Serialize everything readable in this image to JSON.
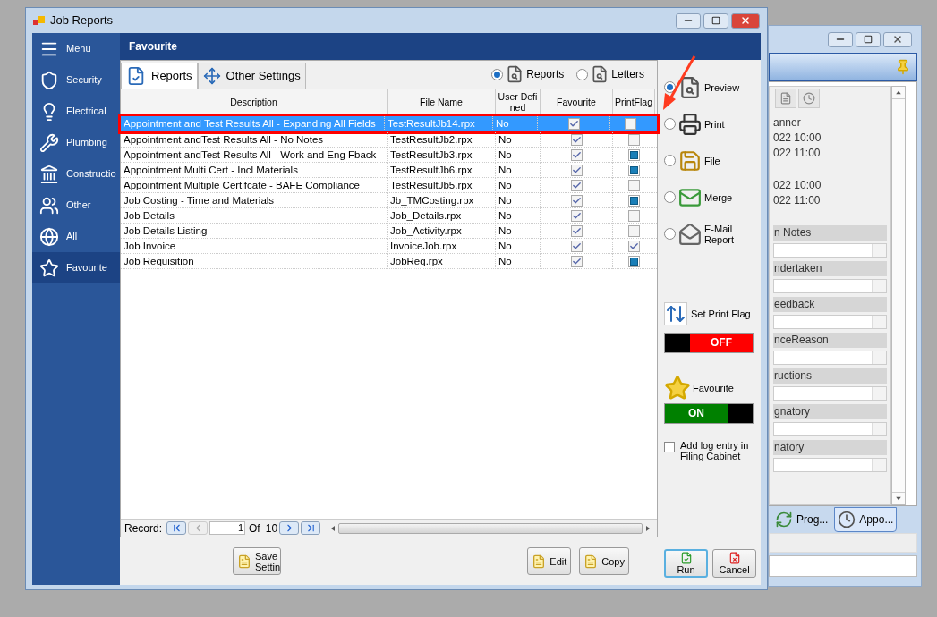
{
  "main_window": {
    "title": "Job Reports",
    "sidebar": [
      {
        "label": "Menu",
        "kind": "menu",
        "selected": false
      },
      {
        "label": "Security",
        "kind": "security",
        "selected": false
      },
      {
        "label": "Electrical",
        "kind": "electrical",
        "selected": false
      },
      {
        "label": "Plumbing",
        "kind": "plumbing",
        "selected": false
      },
      {
        "label": "Constructio",
        "kind": "construction",
        "selected": false
      },
      {
        "label": "Other",
        "kind": "other",
        "selected": false
      },
      {
        "label": "All",
        "kind": "all",
        "selected": false
      },
      {
        "label": "Favourite",
        "kind": "favourite",
        "selected": true
      }
    ],
    "header": "Favourite",
    "tabs": [
      {
        "label": "Reports",
        "kind": "reports",
        "selected": true
      },
      {
        "label": "Other Settings",
        "kind": "settings",
        "selected": false
      }
    ],
    "source_options": [
      {
        "label": "Reports",
        "selected": true
      },
      {
        "label": "Letters",
        "selected": false
      }
    ],
    "table": {
      "columns": [
        "Description",
        "File Name",
        "User Defined",
        "Favourite",
        "PrintFlag"
      ],
      "rows": [
        {
          "description": "Appointment and Test Results All - Expanding All Fields",
          "file_name": "TestResultJb14.rpx",
          "user_defined": "No",
          "favourite": true,
          "print_flag_checked": false,
          "print_flag_indeterminate": false,
          "selected": true
        },
        {
          "description": "Appointment andTest Results All - No Notes",
          "file_name": "TestResultJb2.rpx",
          "user_defined": "No",
          "favourite": true,
          "print_flag_checked": false,
          "print_flag_indeterminate": false,
          "selected": false
        },
        {
          "description": "Appointment andTest Results All - Work and Eng Fback",
          "file_name": "TestResultJb3.rpx",
          "user_defined": "No",
          "favourite": true,
          "print_flag_checked": false,
          "print_flag_indeterminate": true,
          "selected": false
        },
        {
          "description": "Appointment Multi Cert - Incl Materials",
          "file_name": "TestResultJb6.rpx",
          "user_defined": "No",
          "favourite": true,
          "print_flag_checked": false,
          "print_flag_indeterminate": true,
          "selected": false
        },
        {
          "description": "Appointment Multiple Certifcate - BAFE Compliance",
          "file_name": "TestResultJb5.rpx",
          "user_defined": "No",
          "favourite": true,
          "print_flag_checked": false,
          "print_flag_indeterminate": false,
          "selected": false
        },
        {
          "description": "Job Costing - Time and Materials",
          "file_name": "Jb_TMCosting.rpx",
          "user_defined": "No",
          "favourite": true,
          "print_flag_checked": false,
          "print_flag_indeterminate": true,
          "selected": false
        },
        {
          "description": "Job Details",
          "file_name": "Job_Details.rpx",
          "user_defined": "No",
          "favourite": true,
          "print_flag_checked": false,
          "print_flag_indeterminate": false,
          "selected": false
        },
        {
          "description": "Job Details Listing",
          "file_name": "Job_Activity.rpx",
          "user_defined": "No",
          "favourite": true,
          "print_flag_checked": false,
          "print_flag_indeterminate": false,
          "selected": false
        },
        {
          "description": "Job Invoice",
          "file_name": "InvoiceJob.rpx",
          "user_defined": "No",
          "favourite": true,
          "print_flag_checked": true,
          "print_flag_indeterminate": false,
          "selected": false
        },
        {
          "description": "Job Requisition",
          "file_name": "JobReq.rpx",
          "user_defined": "No",
          "favourite": true,
          "print_flag_checked": false,
          "print_flag_indeterminate": true,
          "selected": false
        }
      ]
    },
    "navigator": {
      "label": "Record:",
      "current": "1",
      "of_label": "Of",
      "total": "10"
    },
    "output_options": [
      {
        "label": "Preview",
        "kind": "preview",
        "selected": true
      },
      {
        "label": "Print",
        "kind": "print",
        "selected": false
      },
      {
        "label": "File",
        "kind": "file",
        "selected": false
      },
      {
        "label": "Merge",
        "kind": "merge",
        "selected": false
      },
      {
        "label": "E-Mail Report",
        "kind": "email",
        "selected": false
      }
    ],
    "print_flag_toggle": {
      "label": "Set Print Flag",
      "state_text": "OFF",
      "on": false
    },
    "favourite_toggle": {
      "label": "Favourite",
      "state_text": "ON",
      "on": true
    },
    "log_entry": {
      "label": "Add log entry in Filing Cabinet",
      "checked": false
    },
    "bottom_buttons": [
      "Save Settin",
      "Edit",
      "Copy"
    ],
    "action_buttons": [
      {
        "label": "Run",
        "kind": "run"
      },
      {
        "label": "Cancel",
        "kind": "cancel"
      }
    ]
  },
  "background_window": {
    "detail_groups": [
      {
        "lines": [
          "anner",
          "022 10:00",
          "022 11:00"
        ]
      },
      {
        "lines": [
          "022 10:00",
          "022 11:00"
        ]
      }
    ],
    "sections": [
      "n Notes",
      "ndertaken",
      "eedback",
      "nceReason",
      "ructions",
      "gnatory",
      "natory"
    ],
    "tabs": [
      {
        "label": "Prog...",
        "kind": "progress",
        "selected": false
      },
      {
        "label": "Appo...",
        "kind": "clock",
        "selected": true
      }
    ]
  }
}
